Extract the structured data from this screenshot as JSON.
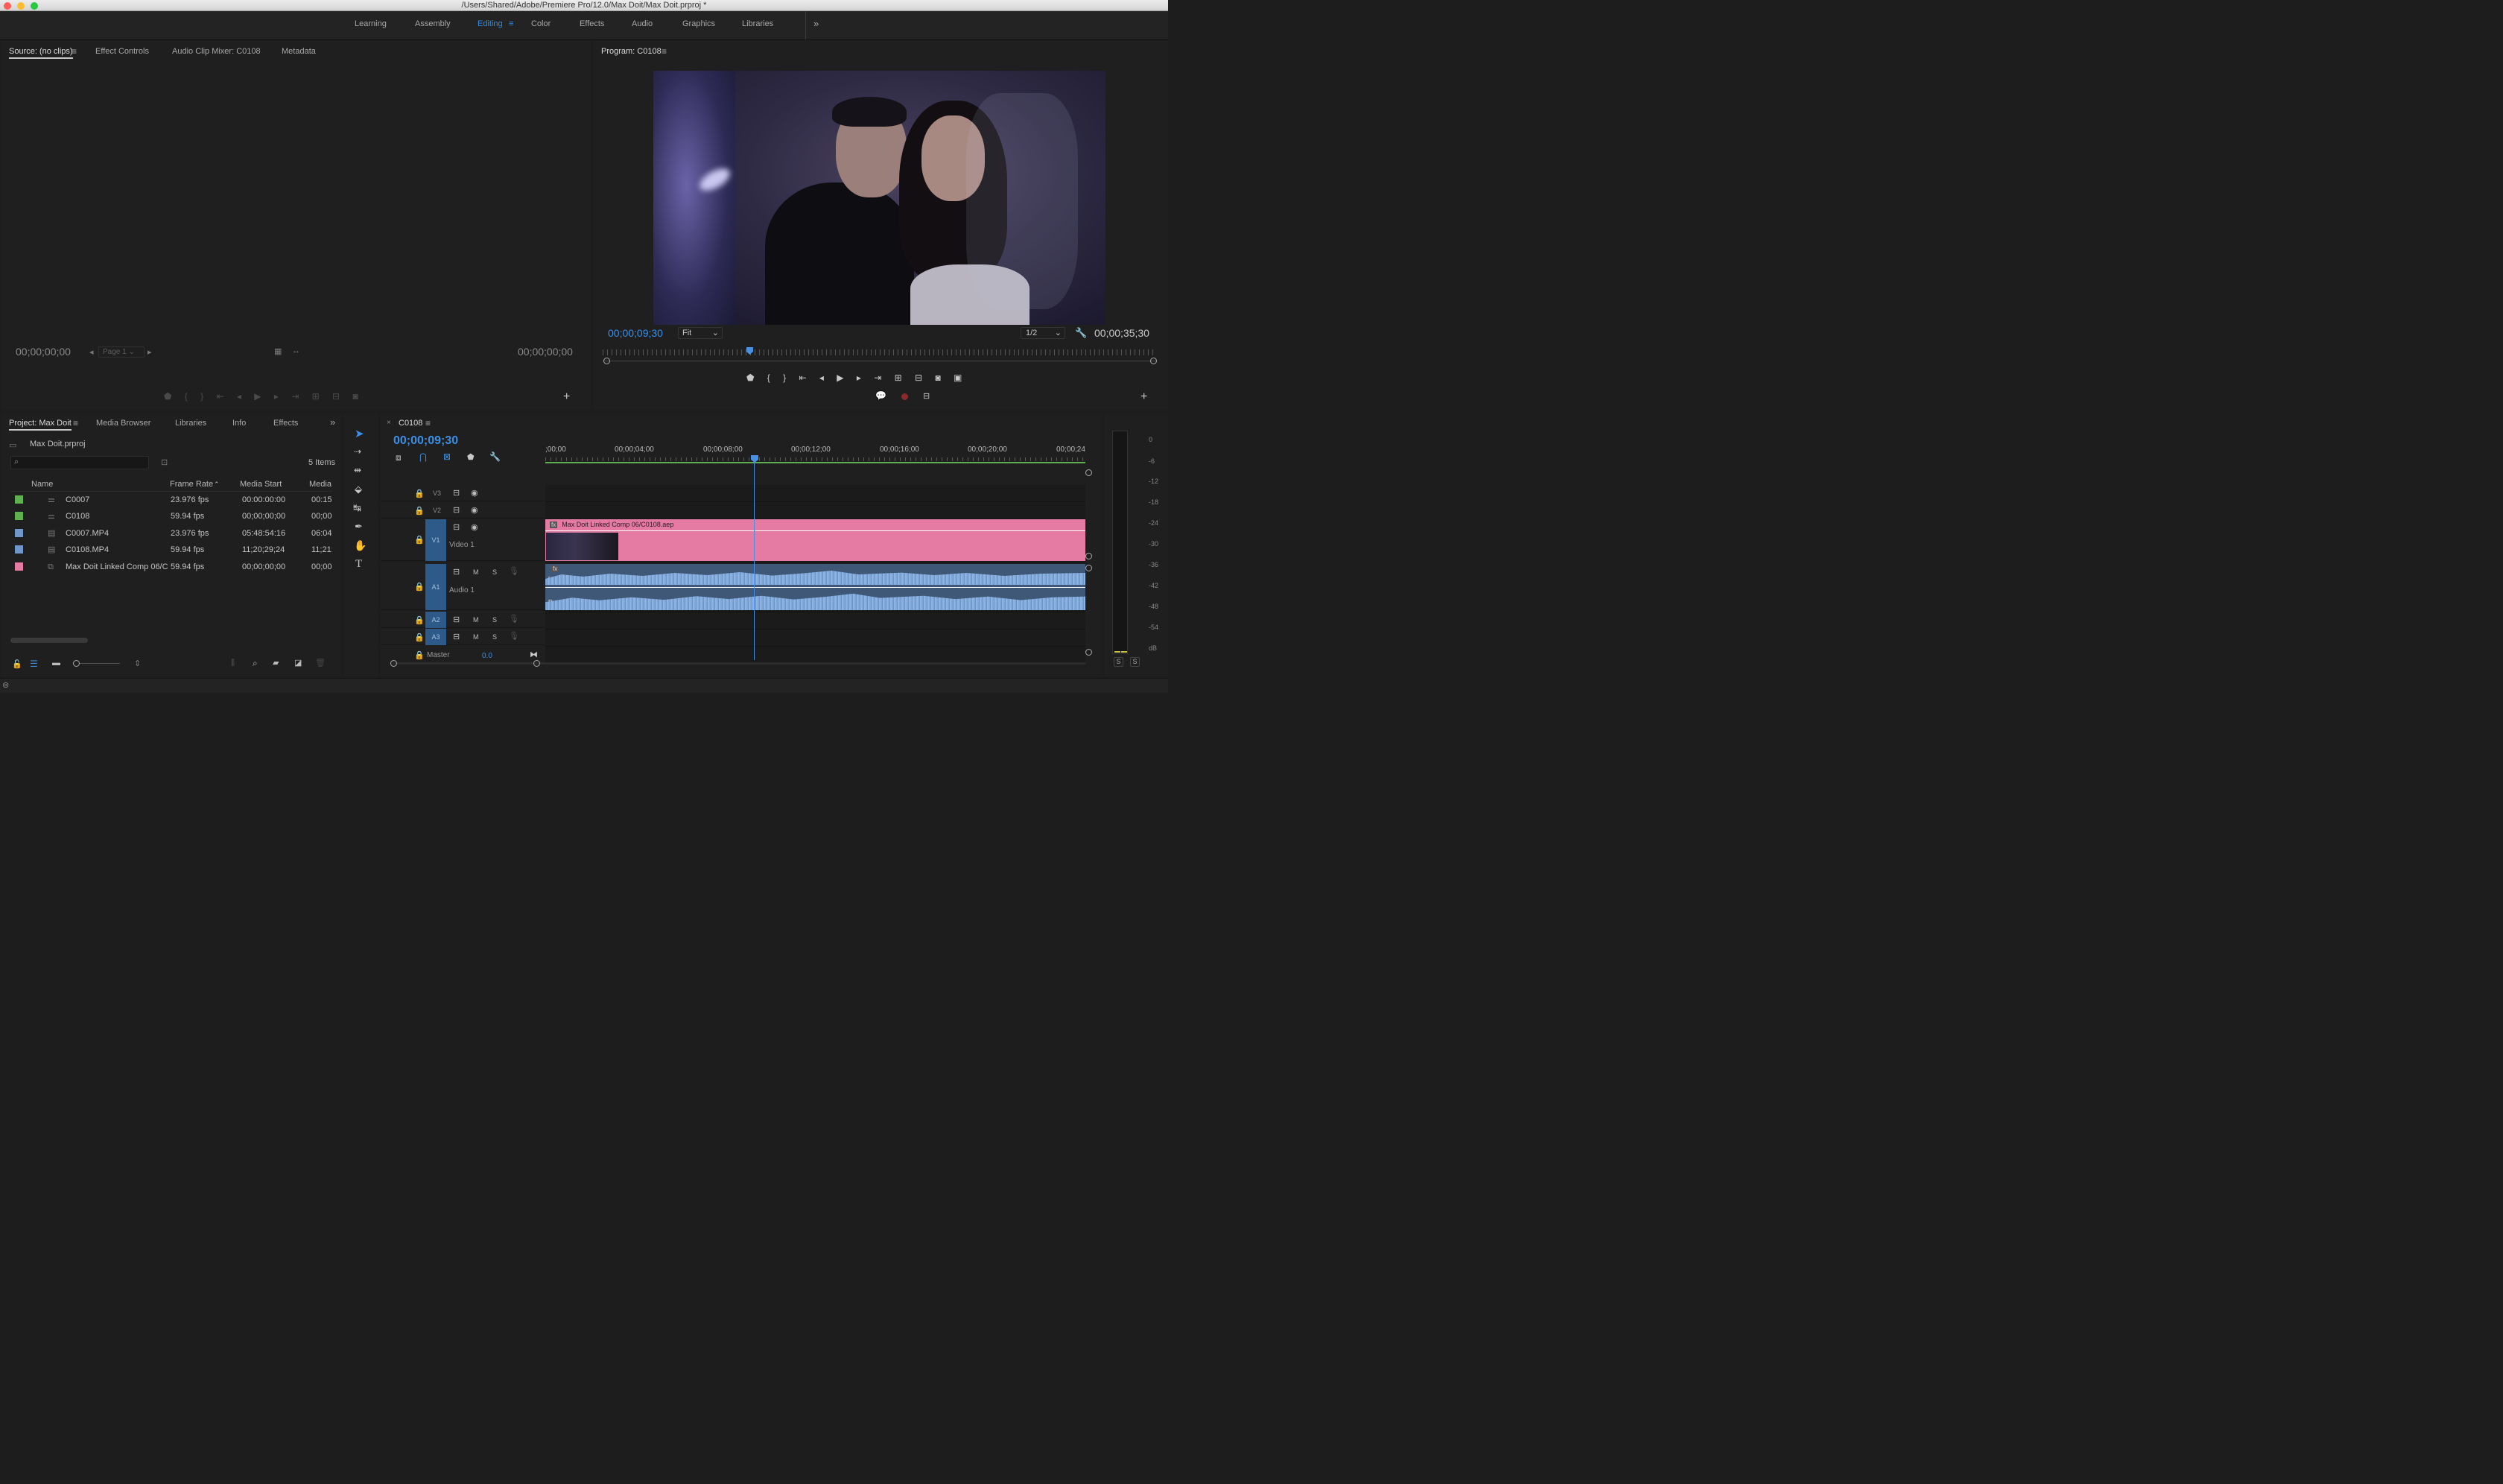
{
  "window": {
    "title": "/Users/Shared/Adobe/Premiere Pro/12.0/Max Doit/Max Doit.prproj *"
  },
  "workspaces": [
    "Learning",
    "Assembly",
    "Editing",
    "Color",
    "Effects",
    "Audio",
    "Graphics",
    "Libraries"
  ],
  "active_workspace": "Editing",
  "source": {
    "tabs": [
      "Source: (no clips)",
      "Effect Controls",
      "Audio Clip Mixer: C0108",
      "Metadata"
    ],
    "tc_left": "00;00;00;00",
    "tc_right": "00;00;00;00",
    "page": "Page 1"
  },
  "program": {
    "title": "Program: C0108",
    "tc_current": "00;00;09;30",
    "fit": "Fit",
    "resolution": "1/2",
    "tc_duration": "00;00;35;30"
  },
  "project": {
    "tabs": [
      "Project: Max Doit",
      "Media Browser",
      "Libraries",
      "Info",
      "Effects"
    ],
    "file": "Max Doit.prproj",
    "items_count": "5 Items",
    "columns": [
      "Name",
      "Frame Rate",
      "Media Start",
      "Media"
    ],
    "rows": [
      {
        "color": "#5fb04f",
        "name": "C0007",
        "fps": "23.976 fps",
        "start": "00:00:00:00",
        "media": "00:15:"
      },
      {
        "color": "#5fb04f",
        "name": "C0108",
        "fps": "59.94 fps",
        "start": "00;00;00;00",
        "media": "00;00;"
      },
      {
        "color": "#6f97c9",
        "name": "C0007.MP4",
        "fps": "23.976 fps",
        "start": "05:48:54:16",
        "media": "06:04:"
      },
      {
        "color": "#6f97c9",
        "name": "C0108.MP4",
        "fps": "59.94 fps",
        "start": "11;20;29;24",
        "media": "11;21;"
      },
      {
        "color": "#e57aa3",
        "name": "Max Doit Linked Comp 06/C",
        "fps": "59.94 fps",
        "start": "00;00;00;00",
        "media": "00;00;"
      }
    ]
  },
  "timeline": {
    "sequence": "C0108",
    "timecode": "00;00;09;30",
    "ruler": [
      ";00;00",
      "00;00;04;00",
      "00;00;08;00",
      "00;00;12;00",
      "00;00;16;00",
      "00;00;20;00",
      "00;00;24"
    ],
    "tracks": {
      "v3": "V3",
      "v2": "V2",
      "v1": "V1",
      "v1_name": "Video 1",
      "a1": "A1",
      "a1_name": "Audio 1",
      "a2": "A2",
      "a3": "A3",
      "master": "Master",
      "master_val": "0.0",
      "m": "M",
      "s": "S"
    },
    "clip_name": "Max Doit Linked Comp 06/C0108.aep",
    "fx": "fx",
    "left_ch": "L",
    "right_ch": "R"
  },
  "meter": {
    "scale": [
      "0",
      "-6",
      "-12",
      "-18",
      "-24",
      "-30",
      "-36",
      "-42",
      "-48",
      "-54",
      "dB"
    ],
    "solo": [
      "S",
      "S"
    ]
  },
  "colors": {
    "accent": "#2d8ceb",
    "clip_pink": "#e57aa3",
    "audio_blue": "#7fa8d8"
  }
}
